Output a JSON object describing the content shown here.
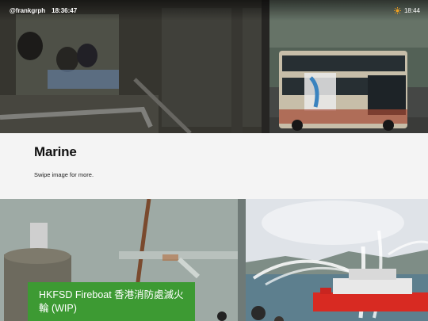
{
  "status": {
    "handle": "@frankgrph",
    "time_left": "18:36:47",
    "time_right": "18:44",
    "weather_icon": "sun-icon"
  },
  "title": {
    "heading": "Marine",
    "subtitle": "Swipe image for more."
  },
  "card": {
    "caption": "HKFSD Fireboat 香港消防處滅火輪 (WIP)",
    "accent": "#3d9a33"
  },
  "colors": {
    "background": "#f4f4f4",
    "title_text": "#111111"
  }
}
